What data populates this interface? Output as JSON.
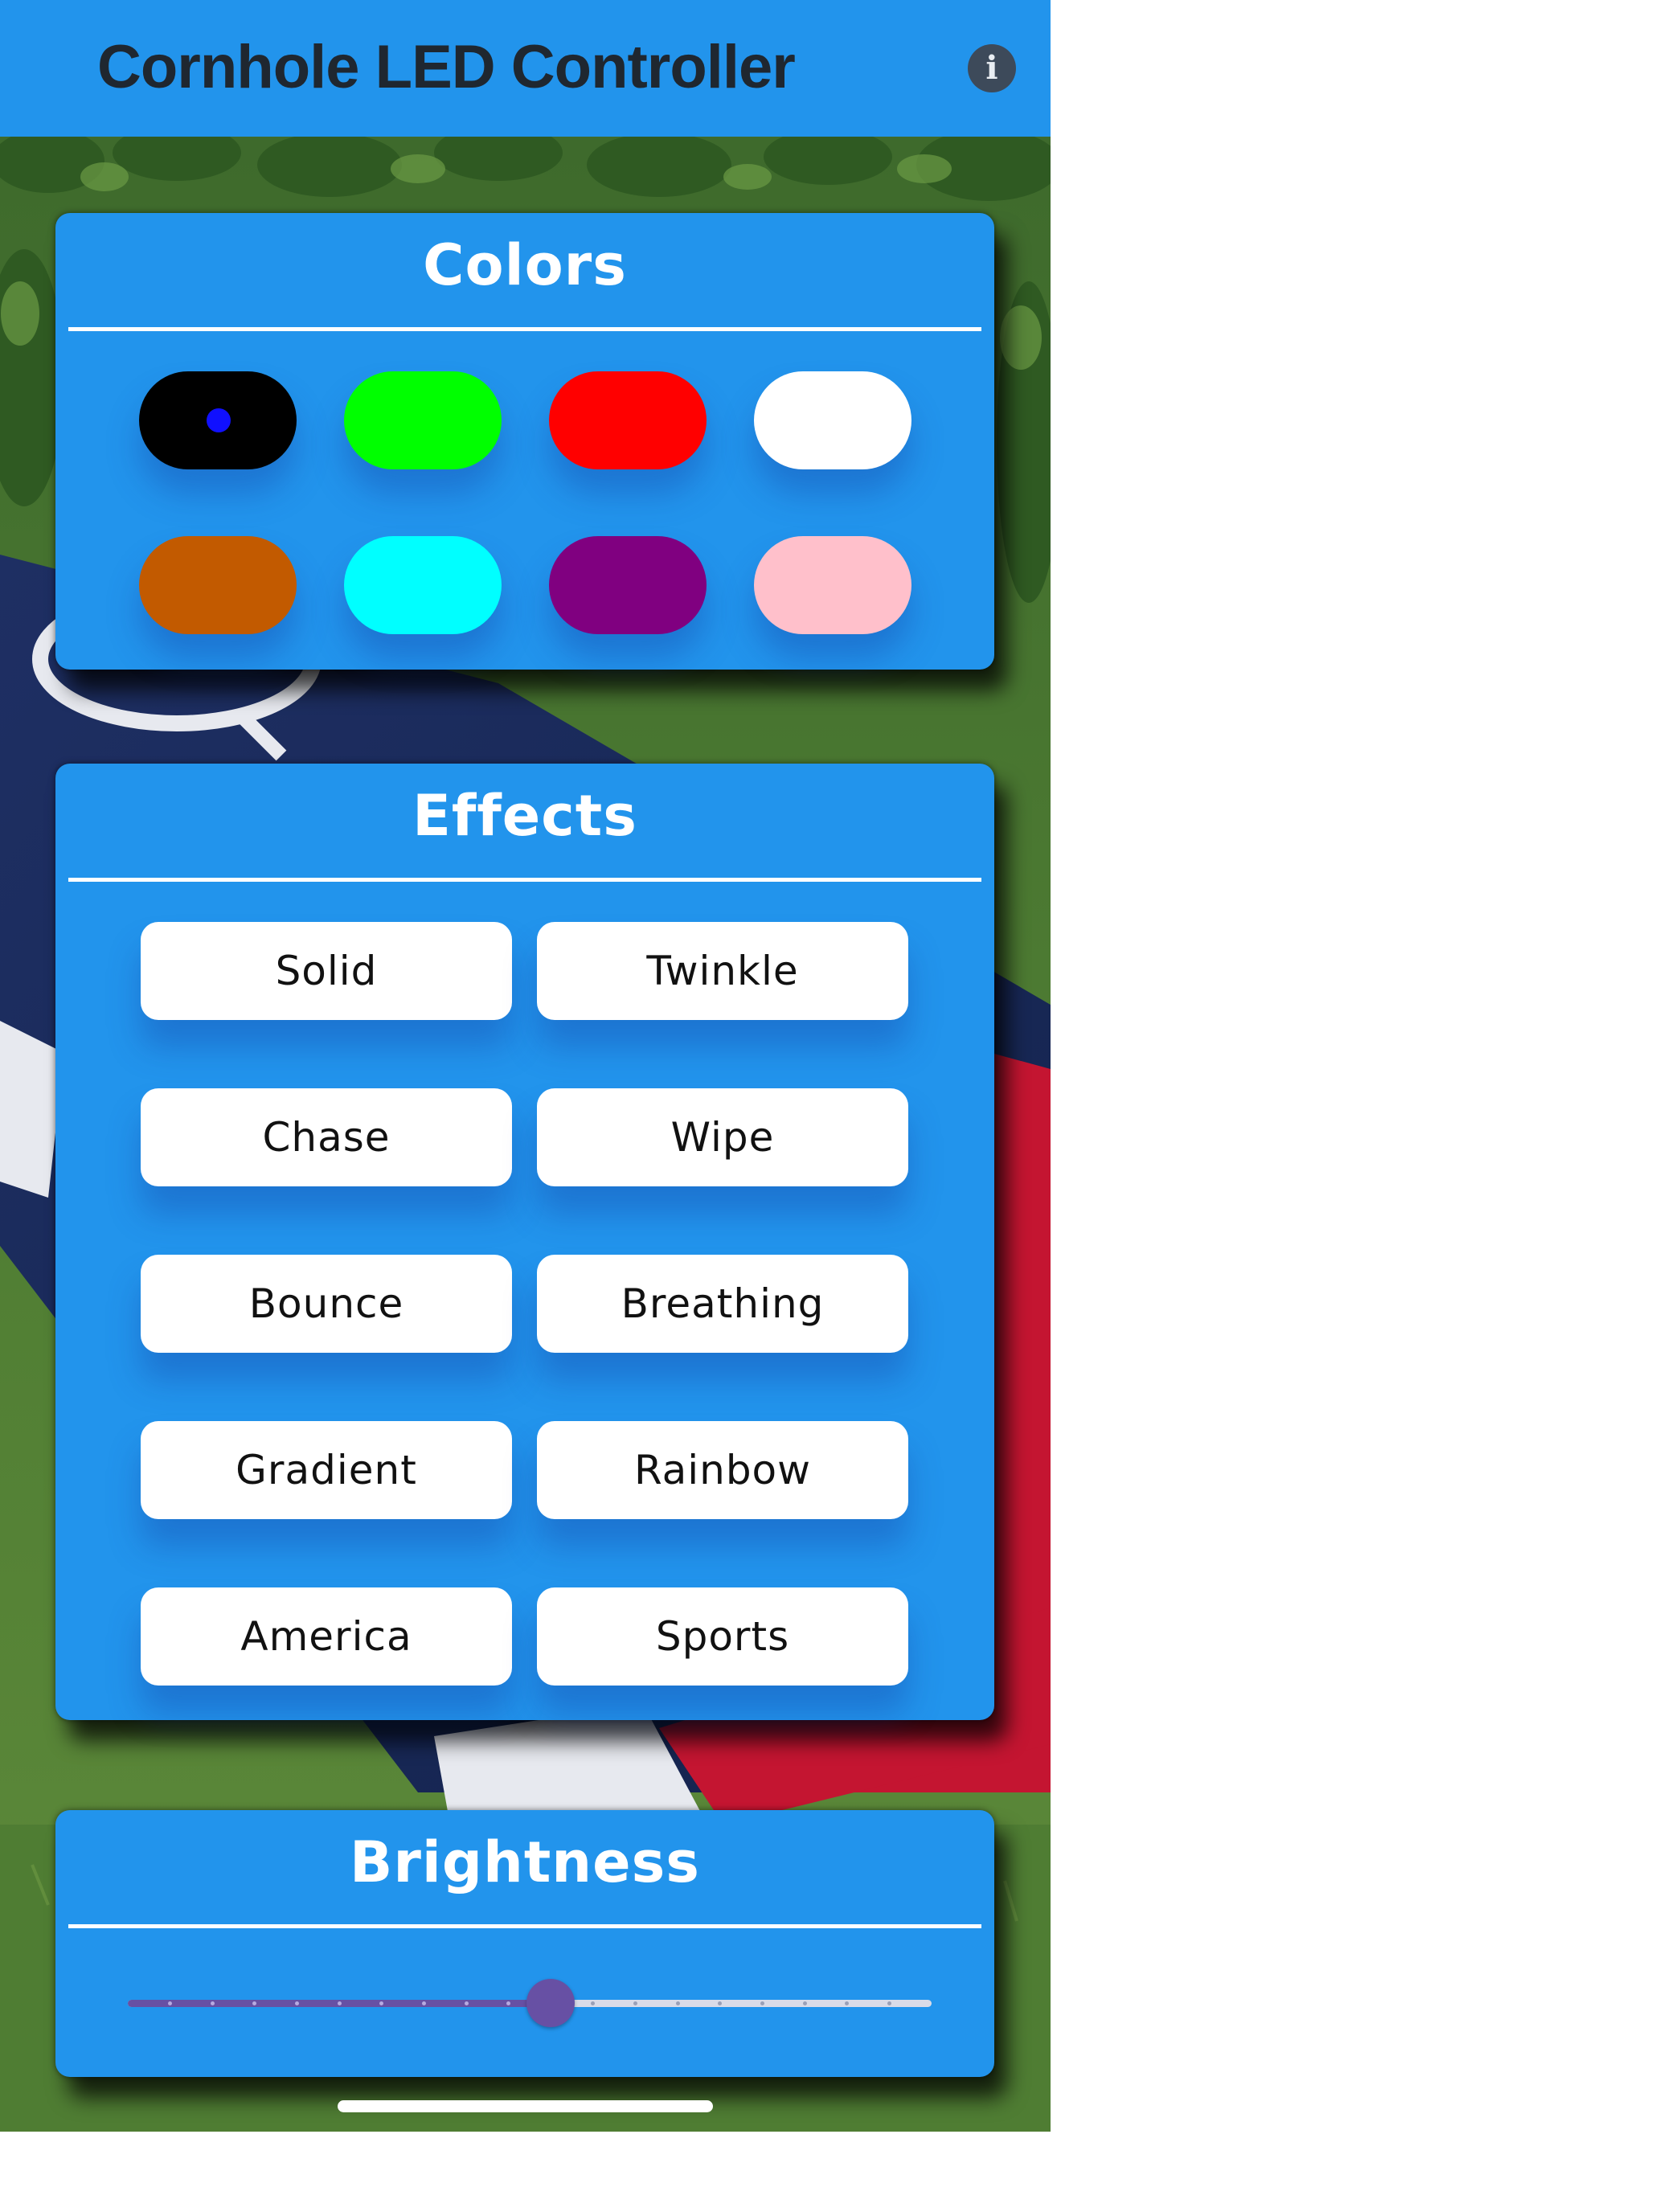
{
  "app_bar": {
    "title": "Cornhole LED Controller",
    "info_icon": "info-icon",
    "info_glyph": "i",
    "background_color": "#2294ec"
  },
  "colors_card": {
    "title": "Colors",
    "swatches": [
      {
        "name": "black",
        "color": "#000000",
        "selected": true
      },
      {
        "name": "green",
        "color": "#00ff00",
        "selected": false
      },
      {
        "name": "red",
        "color": "#ff0000",
        "selected": false
      },
      {
        "name": "white",
        "color": "#ffffff",
        "selected": false
      },
      {
        "name": "orange",
        "color": "#c25a00",
        "selected": false
      },
      {
        "name": "cyan",
        "color": "#00ffff",
        "selected": false
      },
      {
        "name": "purple",
        "color": "#800080",
        "selected": false
      },
      {
        "name": "pink",
        "color": "#ffc0cb",
        "selected": false
      }
    ],
    "selected_indicator_color": "#1010ff"
  },
  "effects_card": {
    "title": "Effects",
    "buttons": [
      {
        "label": "Solid"
      },
      {
        "label": "Twinkle"
      },
      {
        "label": "Chase"
      },
      {
        "label": "Wipe"
      },
      {
        "label": "Bounce"
      },
      {
        "label": "Breathing"
      },
      {
        "label": "Gradient"
      },
      {
        "label": "Rainbow"
      },
      {
        "label": "America"
      },
      {
        "label": "Sports"
      }
    ]
  },
  "brightness_card": {
    "title": "Brightness",
    "slider": {
      "min": 0,
      "max": 1,
      "value": 0.526,
      "divisions": 19,
      "active_color": "#6750a4",
      "inactive_color": "#d9dbe8"
    }
  },
  "colors": {
    "card_background": "#2294ec",
    "card_text": "#ffffff",
    "button_background": "#ffffff",
    "button_text": "#111111"
  }
}
